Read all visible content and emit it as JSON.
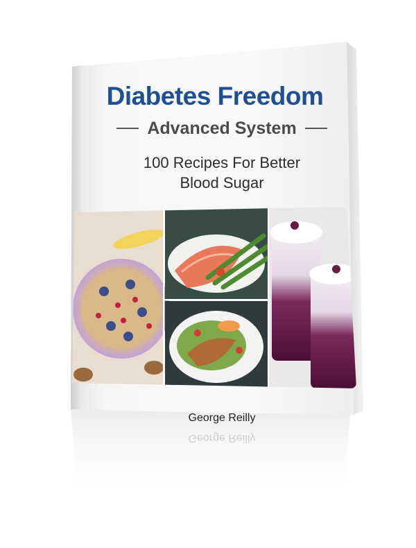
{
  "book": {
    "title": "Diabetes Freedom",
    "subtitle": "Advanced System",
    "tagline_line1": "100 Recipes For Better",
    "tagline_line2": "Blood Sugar",
    "author": "George Reilly"
  },
  "photos": [
    {
      "name": "yogurt-granola-berries-photo"
    },
    {
      "name": "salmon-asparagus-photo"
    },
    {
      "name": "chicken-salad-photo"
    },
    {
      "name": "berry-parfait-photo"
    }
  ],
  "colors": {
    "title": "#1f4f93",
    "subtitle": "#4b4b4b",
    "tagline": "#2d2d2d",
    "author": "#222222"
  }
}
